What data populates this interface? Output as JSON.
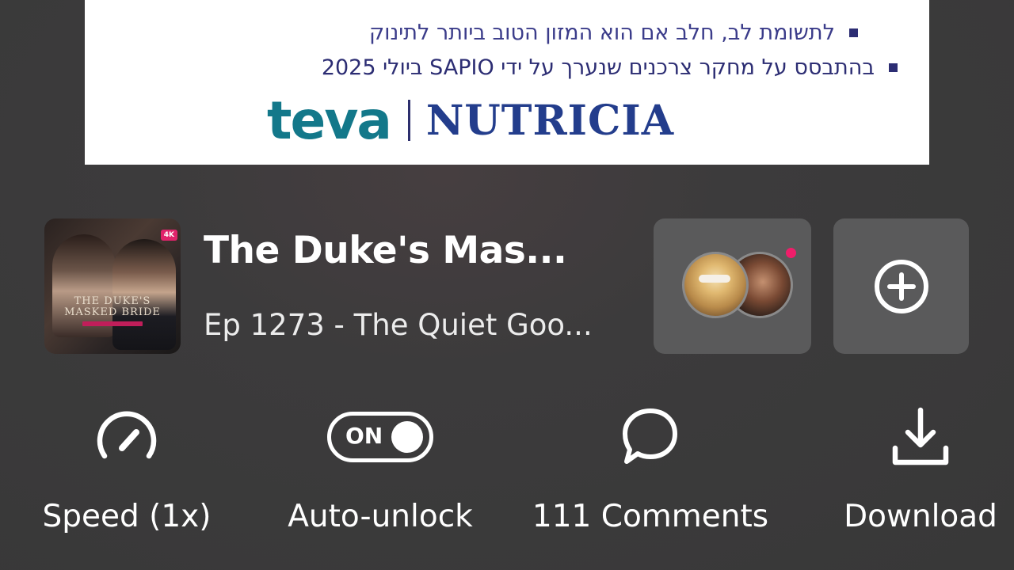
{
  "ad": {
    "line1": "לתשומת לב, חלב אם הוא המזון הטוב ביותר לתינוק",
    "line2": "בהתבסס על מחקר צרכנים שנערך על ידי SAPIO ביולי 2025",
    "logo_left": "teva",
    "logo_right": "NUTRICIA"
  },
  "episode": {
    "cover_badge": "4K",
    "cover_title_line1": "THE DUKE'S",
    "cover_title_line2": "MASKED BRIDE",
    "show_title": "The Duke's Mas...",
    "episode_title": "Ep 1273 - The Quiet Goo..."
  },
  "actions": {
    "speed_label": "Speed (1x)",
    "auto_unlock_label": "Auto-unlock",
    "auto_unlock_state": "ON",
    "comments_label": "111 Comments",
    "download_label": "Download"
  },
  "icons": {
    "speed": "speedometer-icon",
    "auto_unlock": "toggle-on-icon",
    "comments": "chat-bubble-icon",
    "download": "download-icon",
    "add": "plus-circle-icon"
  },
  "colors": {
    "background": "#3b3b3c",
    "card": "#5a5a5b",
    "notification_dot": "#f01d6a",
    "ad_text": "#2c2d73",
    "teva": "#13788a",
    "nutricia": "#233d8c"
  }
}
